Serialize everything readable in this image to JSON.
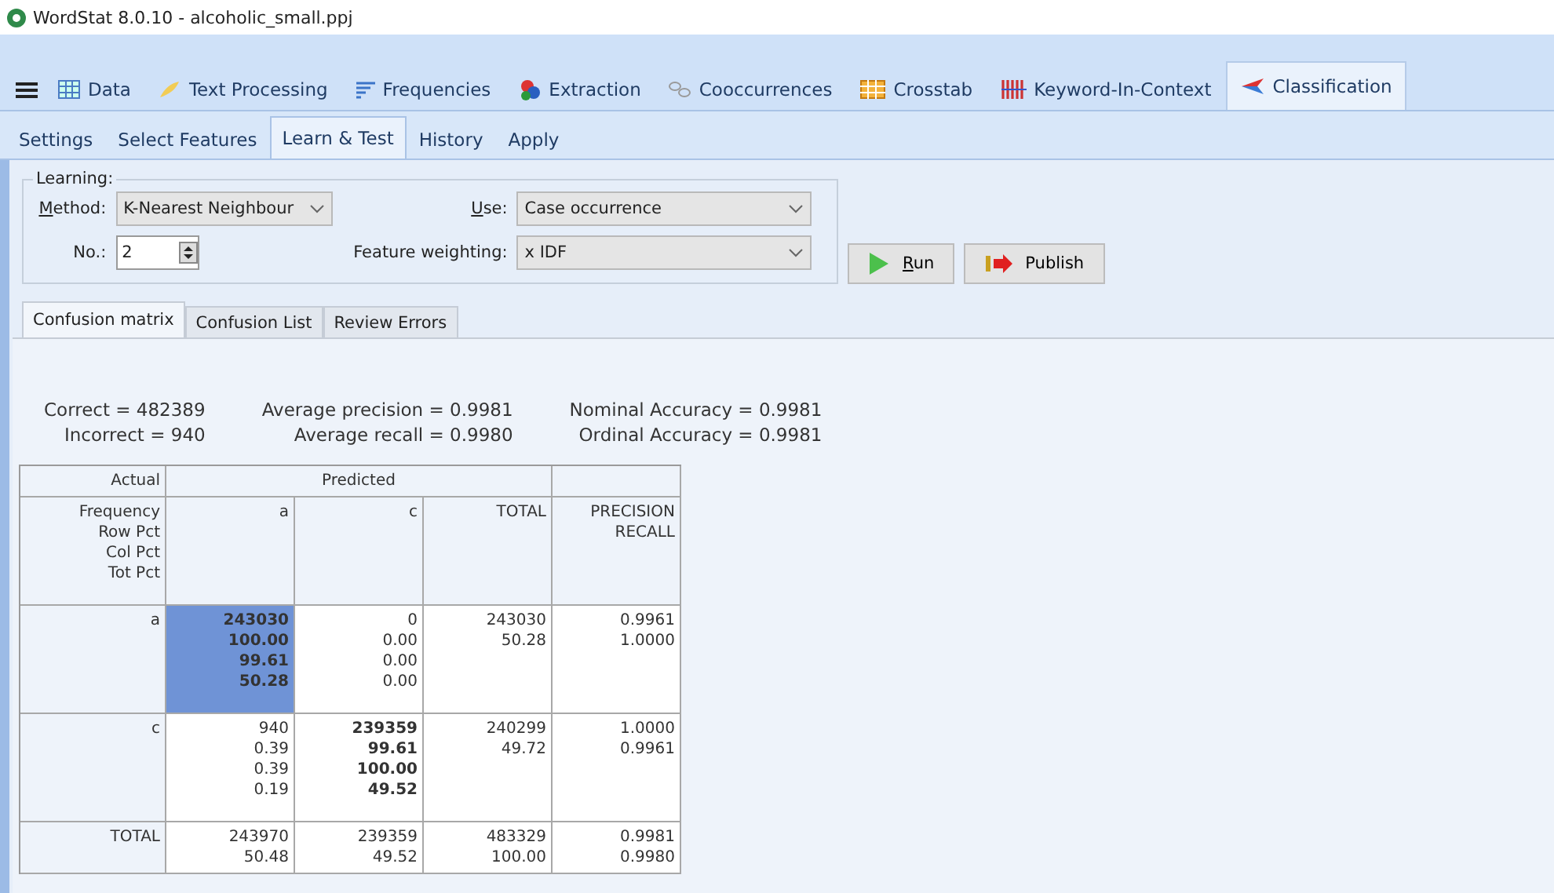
{
  "window": {
    "title": "WordStat 8.0.10 - alcoholic_small.ppj"
  },
  "main_tabs": [
    {
      "label": "Data",
      "selected": false
    },
    {
      "label": "Text Processing",
      "selected": false
    },
    {
      "label": "Frequencies",
      "selected": false
    },
    {
      "label": "Extraction",
      "selected": false
    },
    {
      "label": "Cooccurrences",
      "selected": false
    },
    {
      "label": "Crosstab",
      "selected": false
    },
    {
      "label": "Keyword-In-Context",
      "selected": false
    },
    {
      "label": "Classification",
      "selected": true
    }
  ],
  "sub_tabs": [
    {
      "label": "Settings",
      "selected": false
    },
    {
      "label": "Select Features",
      "selected": false
    },
    {
      "label": "Learn & Test",
      "selected": true
    },
    {
      "label": "History",
      "selected": false
    },
    {
      "label": "Apply",
      "selected": false
    }
  ],
  "learning": {
    "title": "Learning:",
    "method": {
      "label": "Method:",
      "value": "K-Nearest Neighbour"
    },
    "number": {
      "label": "No.:",
      "value": "2"
    },
    "use": {
      "label": "Use:",
      "value": "Case occurrence"
    },
    "weighting": {
      "label": "Feature weighting:",
      "value": "x IDF"
    }
  },
  "buttons": [
    {
      "label": "Run",
      "kind": "run"
    },
    {
      "label": "Publish",
      "kind": "publish"
    }
  ],
  "result_tabs": [
    {
      "label": "Confusion matrix",
      "selected": true
    },
    {
      "label": "Confusion List",
      "selected": false
    },
    {
      "label": "Review Errors",
      "selected": false
    }
  ],
  "stats": [
    [
      "Correct = 482389",
      "Incorrect = 940"
    ],
    [
      "Average precision = 0.9981",
      "Average recall = 0.9980"
    ],
    [
      "Nominal Accuracy = 0.9981",
      "Ordinal Accuracy = 0.9981"
    ]
  ],
  "matrix": {
    "actual_header": "Actual",
    "predicted_header": "Predicted",
    "legend": [
      "Frequency",
      "Row Pct",
      "Col Pct",
      "Tot Pct"
    ],
    "columns": [
      "a",
      "c",
      "TOTAL"
    ],
    "metric_header": [
      "PRECISION",
      "RECALL"
    ],
    "rows": [
      {
        "label": "a",
        "cells": [
          {
            "lines": [
              "243030",
              "100.00",
              "99.61",
              "50.28"
            ],
            "bold": true,
            "selected": true
          },
          {
            "lines": [
              "0",
              "0.00",
              "0.00",
              "0.00"
            ],
            "bold": false,
            "selected": false
          },
          {
            "lines": [
              "243030",
              "50.28"
            ],
            "bold": false,
            "selected": false
          },
          {
            "lines": [
              "0.9961",
              "1.0000"
            ],
            "bold": false,
            "selected": false
          }
        ]
      },
      {
        "label": "c",
        "cells": [
          {
            "lines": [
              "940",
              "0.39",
              "0.39",
              "0.19"
            ],
            "bold": false,
            "selected": false
          },
          {
            "lines": [
              "239359",
              "99.61",
              "100.00",
              "49.52"
            ],
            "bold": true,
            "selected": false
          },
          {
            "lines": [
              "240299",
              "49.72"
            ],
            "bold": false,
            "selected": false
          },
          {
            "lines": [
              "1.0000",
              "0.9961"
            ],
            "bold": false,
            "selected": false
          }
        ]
      },
      {
        "label": "TOTAL",
        "cells": [
          {
            "lines": [
              "243970",
              "50.48"
            ],
            "bold": false,
            "selected": false
          },
          {
            "lines": [
              "239359",
              "49.52"
            ],
            "bold": false,
            "selected": false
          },
          {
            "lines": [
              "483329",
              "100.00"
            ],
            "bold": false,
            "selected": false
          },
          {
            "lines": [
              "0.9981",
              "0.9980"
            ],
            "bold": false,
            "selected": false
          }
        ]
      }
    ]
  }
}
